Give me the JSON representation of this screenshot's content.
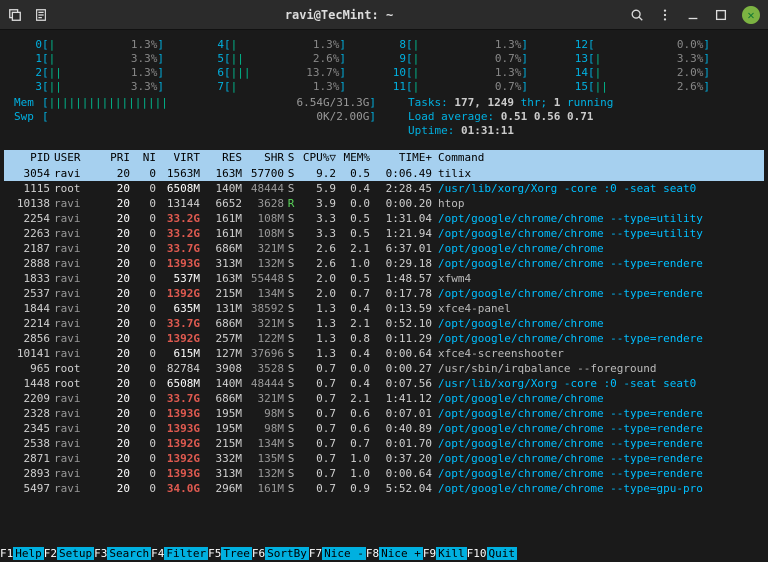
{
  "titlebar": {
    "title": "ravi@TecMint: ~"
  },
  "cpu_meters": [
    {
      "id": "0",
      "bar": "|",
      "pct": "1.3%"
    },
    {
      "id": "1",
      "bar": "|",
      "pct": "3.3%"
    },
    {
      "id": "2",
      "bar": "||",
      "pct": "1.3%"
    },
    {
      "id": "3",
      "bar": "||",
      "pct": "3.3%"
    },
    {
      "id": "4",
      "bar": "|",
      "pct": "1.3%"
    },
    {
      "id": "5",
      "bar": "||",
      "pct": "2.6%"
    },
    {
      "id": "6",
      "bar": "|||",
      "pct": "13.7%"
    },
    {
      "id": "7",
      "bar": "|",
      "pct": "1.3%"
    },
    {
      "id": "8",
      "bar": "|",
      "pct": "1.3%"
    },
    {
      "id": "9",
      "bar": "|",
      "pct": "0.7%"
    },
    {
      "id": "10",
      "bar": "|",
      "pct": "1.3%"
    },
    {
      "id": "11",
      "bar": "|",
      "pct": "0.7%"
    },
    {
      "id": "12",
      "bar": "",
      "pct": "0.0%"
    },
    {
      "id": "13",
      "bar": "|",
      "pct": "3.3%"
    },
    {
      "id": "14",
      "bar": "|",
      "pct": "2.0%"
    },
    {
      "id": "15",
      "bar": "||",
      "pct": "2.6%"
    }
  ],
  "mem": {
    "label": "Mem",
    "bar": "||||||||||||||||||",
    "val": "6.54G/31.3G"
  },
  "swp": {
    "label": "Swp",
    "bar": "",
    "val": "0K/2.00G"
  },
  "sys": {
    "tasks_label": "Tasks:",
    "tasks": "177,",
    "threads": "1249",
    "thr_label": "thr;",
    "running": "1",
    "running_label": "running",
    "load_label": "Load average:",
    "load": "0.51 0.56 0.71",
    "uptime_label": "Uptime:",
    "uptime": "01:31:11"
  },
  "header": [
    "PID",
    "USER",
    "PRI",
    "NI",
    "VIRT",
    "RES",
    "SHR",
    "S",
    "CPU%",
    "MEM%",
    "TIME+",
    "Command"
  ],
  "sort_col": "CPU%",
  "sort_glyph": "▽",
  "procs": [
    {
      "pid": "3054",
      "user": "ravi",
      "pri": "20",
      "ni": "0",
      "virt": "1563M",
      "vm": true,
      "res": "163M",
      "shr": "57700",
      "s": "S",
      "cpu": "9.2",
      "mem": "0.5",
      "time": "0:06.49",
      "cmd": "tilix",
      "hl": false,
      "sel": true
    },
    {
      "pid": "1115",
      "user": "root",
      "pri": "20",
      "ni": "0",
      "virt": "6508M",
      "vm": true,
      "res": "140M",
      "shr": "48444",
      "s": "S",
      "cpu": "5.9",
      "mem": "0.4",
      "time": "2:28.45",
      "cmd": "/usr/lib/xorg/Xorg -core :0 -seat seat0",
      "hl": true
    },
    {
      "pid": "10138",
      "user": "ravi",
      "pri": "20",
      "ni": "0",
      "virt": "13144",
      "vm": false,
      "res": "6652",
      "shr": "3628",
      "s": "R",
      "cpu": "3.9",
      "mem": "0.0",
      "time": "0:00.20",
      "cmd": "htop",
      "hl": false
    },
    {
      "pid": "2254",
      "user": "ravi",
      "pri": "20",
      "ni": "0",
      "virt": "33.2G",
      "vg": true,
      "res": "161M",
      "shr": "108M",
      "s": "S",
      "cpu": "3.3",
      "mem": "0.5",
      "time": "1:31.04",
      "cmd": "/opt/google/chrome/chrome --type=utility",
      "hl": true
    },
    {
      "pid": "2263",
      "user": "ravi",
      "pri": "20",
      "ni": "0",
      "virt": "33.2G",
      "vg": true,
      "res": "161M",
      "shr": "108M",
      "s": "S",
      "cpu": "3.3",
      "mem": "0.5",
      "time": "1:21.94",
      "cmd": "/opt/google/chrome/chrome --type=utility",
      "hl": true
    },
    {
      "pid": "2187",
      "user": "ravi",
      "pri": "20",
      "ni": "0",
      "virt": "33.7G",
      "vg": true,
      "res": "686M",
      "shr": "321M",
      "s": "S",
      "cpu": "2.6",
      "mem": "2.1",
      "time": "6:37.01",
      "cmd": "/opt/google/chrome/chrome",
      "hl": true
    },
    {
      "pid": "2888",
      "user": "ravi",
      "pri": "20",
      "ni": "0",
      "virt": "1393G",
      "vg": true,
      "res": "313M",
      "shr": "132M",
      "s": "S",
      "cpu": "2.6",
      "mem": "1.0",
      "time": "0:29.18",
      "cmd": "/opt/google/chrome/chrome --type=rendere",
      "hl": true
    },
    {
      "pid": "1833",
      "user": "ravi",
      "pri": "20",
      "ni": "0",
      "virt": "537M",
      "vm": true,
      "res": "163M",
      "shr": "55448",
      "s": "S",
      "cpu": "2.0",
      "mem": "0.5",
      "time": "1:48.57",
      "cmd": "xfwm4",
      "hl": false
    },
    {
      "pid": "2537",
      "user": "ravi",
      "pri": "20",
      "ni": "0",
      "virt": "1392G",
      "vg": true,
      "res": "215M",
      "shr": "134M",
      "s": "S",
      "cpu": "2.0",
      "mem": "0.7",
      "time": "0:17.78",
      "cmd": "/opt/google/chrome/chrome --type=rendere",
      "hl": true
    },
    {
      "pid": "1844",
      "user": "ravi",
      "pri": "20",
      "ni": "0",
      "virt": "635M",
      "vm": true,
      "res": "131M",
      "shr": "38592",
      "s": "S",
      "cpu": "1.3",
      "mem": "0.4",
      "time": "0:13.59",
      "cmd": "xfce4-panel",
      "hl": false
    },
    {
      "pid": "2214",
      "user": "ravi",
      "pri": "20",
      "ni": "0",
      "virt": "33.7G",
      "vg": true,
      "res": "686M",
      "shr": "321M",
      "s": "S",
      "cpu": "1.3",
      "mem": "2.1",
      "time": "0:52.10",
      "cmd": "/opt/google/chrome/chrome",
      "hl": true
    },
    {
      "pid": "2856",
      "user": "ravi",
      "pri": "20",
      "ni": "0",
      "virt": "1392G",
      "vg": true,
      "res": "257M",
      "shr": "122M",
      "s": "S",
      "cpu": "1.3",
      "mem": "0.8",
      "time": "0:11.29",
      "cmd": "/opt/google/chrome/chrome --type=rendere",
      "hl": true
    },
    {
      "pid": "10141",
      "user": "ravi",
      "pri": "20",
      "ni": "0",
      "virt": "615M",
      "vm": true,
      "res": "127M",
      "shr": "37696",
      "s": "S",
      "cpu": "1.3",
      "mem": "0.4",
      "time": "0:00.64",
      "cmd": "xfce4-screenshooter",
      "hl": false
    },
    {
      "pid": "965",
      "user": "root",
      "pri": "20",
      "ni": "0",
      "virt": "82784",
      "vm": false,
      "res": "3908",
      "shr": "3528",
      "s": "S",
      "cpu": "0.7",
      "mem": "0.0",
      "time": "0:00.27",
      "cmd": "/usr/sbin/irqbalance --foreground",
      "hl": false
    },
    {
      "pid": "1448",
      "user": "root",
      "pri": "20",
      "ni": "0",
      "virt": "6508M",
      "vm": true,
      "res": "140M",
      "shr": "48444",
      "s": "S",
      "cpu": "0.7",
      "mem": "0.4",
      "time": "0:07.56",
      "cmd": "/usr/lib/xorg/Xorg -core :0 -seat seat0",
      "hl": true
    },
    {
      "pid": "2209",
      "user": "ravi",
      "pri": "20",
      "ni": "0",
      "virt": "33.7G",
      "vg": true,
      "res": "686M",
      "shr": "321M",
      "s": "S",
      "cpu": "0.7",
      "mem": "2.1",
      "time": "1:41.12",
      "cmd": "/opt/google/chrome/chrome",
      "hl": true
    },
    {
      "pid": "2328",
      "user": "ravi",
      "pri": "20",
      "ni": "0",
      "virt": "1393G",
      "vg": true,
      "res": "195M",
      "shr": "98M",
      "s": "S",
      "cpu": "0.7",
      "mem": "0.6",
      "time": "0:07.01",
      "cmd": "/opt/google/chrome/chrome --type=rendere",
      "hl": true
    },
    {
      "pid": "2345",
      "user": "ravi",
      "pri": "20",
      "ni": "0",
      "virt": "1393G",
      "vg": true,
      "res": "195M",
      "shr": "98M",
      "s": "S",
      "cpu": "0.7",
      "mem": "0.6",
      "time": "0:40.89",
      "cmd": "/opt/google/chrome/chrome --type=rendere",
      "hl": true
    },
    {
      "pid": "2538",
      "user": "ravi",
      "pri": "20",
      "ni": "0",
      "virt": "1392G",
      "vg": true,
      "res": "215M",
      "shr": "134M",
      "s": "S",
      "cpu": "0.7",
      "mem": "0.7",
      "time": "0:01.70",
      "cmd": "/opt/google/chrome/chrome --type=rendere",
      "hl": true
    },
    {
      "pid": "2871",
      "user": "ravi",
      "pri": "20",
      "ni": "0",
      "virt": "1392G",
      "vg": true,
      "res": "332M",
      "shr": "135M",
      "s": "S",
      "cpu": "0.7",
      "mem": "1.0",
      "time": "0:37.20",
      "cmd": "/opt/google/chrome/chrome --type=rendere",
      "hl": true
    },
    {
      "pid": "2893",
      "user": "ravi",
      "pri": "20",
      "ni": "0",
      "virt": "1393G",
      "vg": true,
      "res": "313M",
      "shr": "132M",
      "s": "S",
      "cpu": "0.7",
      "mem": "1.0",
      "time": "0:00.64",
      "cmd": "/opt/google/chrome/chrome --type=rendere",
      "hl": true
    },
    {
      "pid": "5497",
      "user": "ravi",
      "pri": "20",
      "ni": "0",
      "virt": "34.0G",
      "vg": true,
      "res": "296M",
      "shr": "161M",
      "s": "S",
      "cpu": "0.7",
      "mem": "0.9",
      "time": "5:52.04",
      "cmd": "/opt/google/chrome/chrome --type=gpu-pro",
      "hl": true
    }
  ],
  "footer": [
    {
      "key": "F1",
      "label": "Help"
    },
    {
      "key": "F2",
      "label": "Setup "
    },
    {
      "key": "F3",
      "label": "Search"
    },
    {
      "key": "F4",
      "label": "Filter"
    },
    {
      "key": "F5",
      "label": "Tree  "
    },
    {
      "key": "F6",
      "label": "SortBy"
    },
    {
      "key": "F7",
      "label": "Nice -"
    },
    {
      "key": "F8",
      "label": "Nice +"
    },
    {
      "key": "F9",
      "label": "Kill  "
    },
    {
      "key": "F10",
      "label": "Quit  "
    }
  ]
}
